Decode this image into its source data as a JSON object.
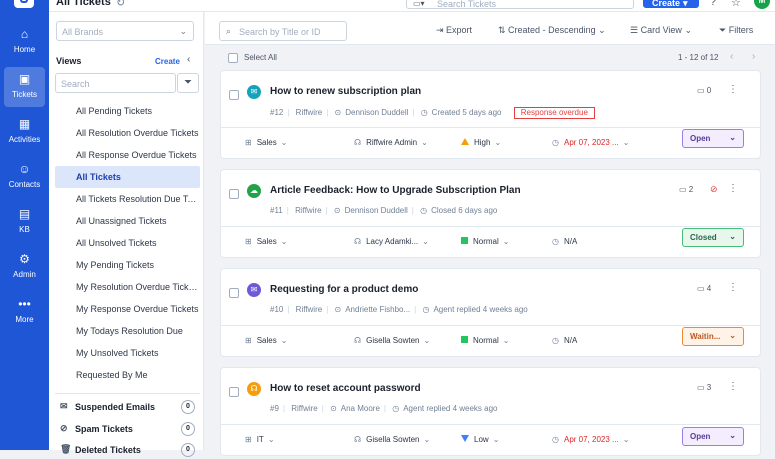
{
  "topbar": {
    "title": "All Tickets",
    "search_placeholder": "Search Tickets",
    "create_label": "Create",
    "avatar": "M"
  },
  "nav": [
    {
      "label": "Home",
      "icon": "⌂"
    },
    {
      "label": "Tickets",
      "icon": "▣"
    },
    {
      "label": "Activities",
      "icon": "▦"
    },
    {
      "label": "Contacts",
      "icon": "☺"
    },
    {
      "label": "KB",
      "icon": "▤"
    },
    {
      "label": "Admin",
      "icon": "⚙"
    },
    {
      "label": "More",
      "icon": "•••"
    }
  ],
  "brands": {
    "placeholder": "All Brands"
  },
  "views": {
    "heading": "Views",
    "create": "Create",
    "search_placeholder": "Search",
    "items": [
      "All Pending Tickets",
      "All Resolution Overdue Tickets",
      "All Response Overdue Tickets",
      "All Tickets",
      "All Tickets Resolution Due Today",
      "All Unassigned Tickets",
      "All Unsolved Tickets",
      "My Pending Tickets",
      "My Resolution Overdue Tickets",
      "My Response Overdue Tickets",
      "My Todays Resolution Due",
      "My Unsolved Tickets",
      "Requested By Me"
    ],
    "sections": [
      {
        "label": "Suspended Emails",
        "count": "0"
      },
      {
        "label": "Spam Tickets",
        "count": "0"
      },
      {
        "label": "Deleted Tickets",
        "count": "0"
      }
    ]
  },
  "toolbar": {
    "search_placeholder": "Search by Title or ID",
    "export": "Export",
    "sort": "Created - Descending",
    "view": "Card View",
    "filters": "Filters"
  },
  "list": {
    "select_all": "Select All",
    "pager": "1 - 12 of 12"
  },
  "tickets": [
    {
      "title": "How to renew subscription plan",
      "id": "#12",
      "brand": "Riffwire",
      "contact": "Dennison Duddell",
      "time": "Created 5 days ago",
      "badge": "Response overdue",
      "comments": "0",
      "category": "Sales",
      "agent": "Riffwire Admin",
      "priority": "High",
      "due": "Apr 07, 2023 ...",
      "status": "Open"
    },
    {
      "title": "Article Feedback: How to Upgrade Subscription Plan",
      "id": "#11",
      "brand": "Riffwire",
      "contact": "Dennison Duddell",
      "time": "Closed 6 days ago",
      "comments": "2",
      "category": "Sales",
      "agent": "Lacy Adamki...",
      "priority": "Normal",
      "due": "N/A",
      "status": "Closed"
    },
    {
      "title": "Requesting for a product demo",
      "id": "#10",
      "brand": "Riffwire",
      "contact": "Andriette Fishbo...",
      "time": "Agent replied 4 weeks ago",
      "comments": "4",
      "category": "Sales",
      "agent": "Gisella Sowten",
      "priority": "Normal",
      "due": "N/A",
      "status": "Waitin..."
    },
    {
      "title": "How to reset account password",
      "id": "#9",
      "brand": "Riffwire",
      "contact": "Ana Moore",
      "time": "Agent replied 4 weeks ago",
      "comments": "3",
      "category": "IT",
      "agent": "Gisella Sowten",
      "priority": "Low",
      "due": "Apr 07, 2023 ...",
      "status": "Open"
    }
  ],
  "colors": {
    "accent": "#2563eb",
    "nav": "#1e56d6",
    "overdue": "#e53e3e"
  }
}
